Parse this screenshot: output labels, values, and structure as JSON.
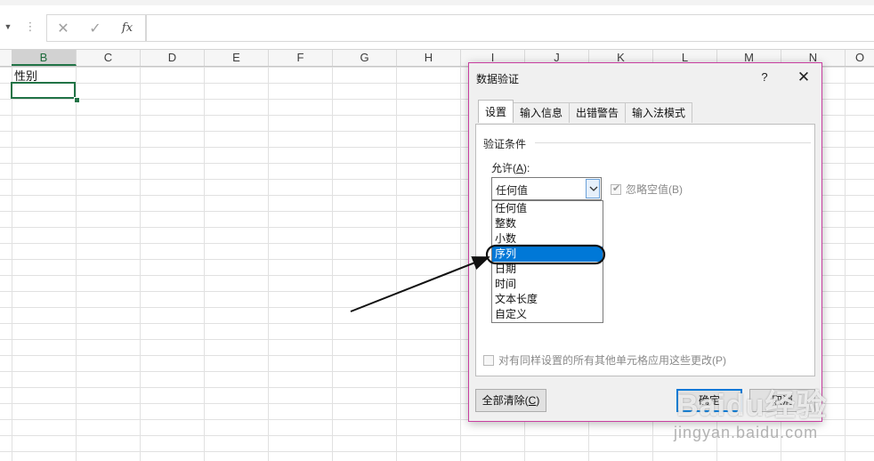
{
  "formula_bar": {
    "cancel_icon": "close-icon",
    "enter_icon": "check-icon",
    "fx_label": "fx",
    "content": ""
  },
  "columns": [
    "B",
    "C",
    "D",
    "E",
    "F",
    "G",
    "H",
    "I",
    "J",
    "K",
    "L",
    "M",
    "N",
    "O"
  ],
  "cells": {
    "B1": "性别"
  },
  "dialog": {
    "title": "数据验证",
    "help": "?",
    "tabs": [
      "设置",
      "输入信息",
      "出错警告",
      "输入法模式"
    ],
    "active_tab": "设置",
    "group_label": "验证条件",
    "allow_label": "允许(A):",
    "allow_label_main": "允许(",
    "allow_label_key": "A",
    "allow_label_tail": "):",
    "allow_value": "任何值",
    "ignore_blank_label": "忽略空值(B)",
    "ignore_blank_checked": true,
    "options": [
      "任何值",
      "整数",
      "小数",
      "序列",
      "日期",
      "时间",
      "文本长度",
      "自定义"
    ],
    "selected_option": "序列",
    "apply_all_label": "对有同样设置的所有其他单元格应用这些更改(P)",
    "apply_all_checked": false,
    "clear_all_main": "全部清除(",
    "clear_all_key": "C",
    "clear_all_tail": ")",
    "ok_label": "确定",
    "cancel_label": "取消"
  },
  "accent_colors": {
    "excel_green": "#217346",
    "selection_blue": "#0078d7",
    "dialog_border": "#c83ea0"
  },
  "watermark": {
    "logo": "Baidu经验",
    "url": "jingyan.baidu.com"
  }
}
